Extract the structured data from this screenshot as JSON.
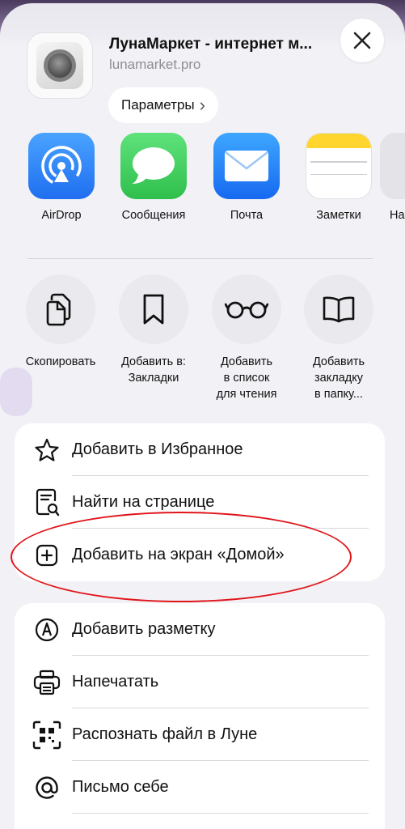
{
  "header": {
    "site_title": "ЛунаМаркет - интернет м...",
    "site_url": "lunamarket.pro",
    "params_label": "Параметры",
    "params_chevron": "›"
  },
  "apps": [
    {
      "label": "AirDrop",
      "icon": "airdrop-icon"
    },
    {
      "label": "Сообщения",
      "icon": "messages-icon"
    },
    {
      "label": "Почта",
      "icon": "mail-icon"
    },
    {
      "label": "Заметки",
      "icon": "notes-icon"
    },
    {
      "label": "На",
      "icon": "more-app-icon"
    }
  ],
  "actions": [
    {
      "label": "Скопировать",
      "icon": "copy-icon"
    },
    {
      "label": "Добавить в:\nЗакладки",
      "icon": "bookmark-icon"
    },
    {
      "label": "Добавить\nв список\nдля чтения",
      "icon": "reading-list-icon"
    },
    {
      "label": "Добавить\nзакладку\nв папку...",
      "icon": "book-icon"
    }
  ],
  "menu_group1": [
    {
      "label": "Добавить в Избранное",
      "icon": "star-icon"
    },
    {
      "label": "Найти на странице",
      "icon": "find-icon"
    },
    {
      "label": "Добавить на экран «Домой»",
      "icon": "add-square-icon"
    }
  ],
  "menu_group2": [
    {
      "label": "Добавить разметку",
      "icon": "markup-icon"
    },
    {
      "label": "Напечатать",
      "icon": "printer-icon"
    },
    {
      "label": "Распознать файл в Луне",
      "icon": "scan-icon"
    },
    {
      "label": "Письмо себе",
      "icon": "at-icon"
    }
  ],
  "colors": {
    "airdrop": "#2f7cf6",
    "messages": "#34c759",
    "mail": "#1a82fb",
    "notes_top": "#ffd52e",
    "annotation": "#e0151a"
  }
}
